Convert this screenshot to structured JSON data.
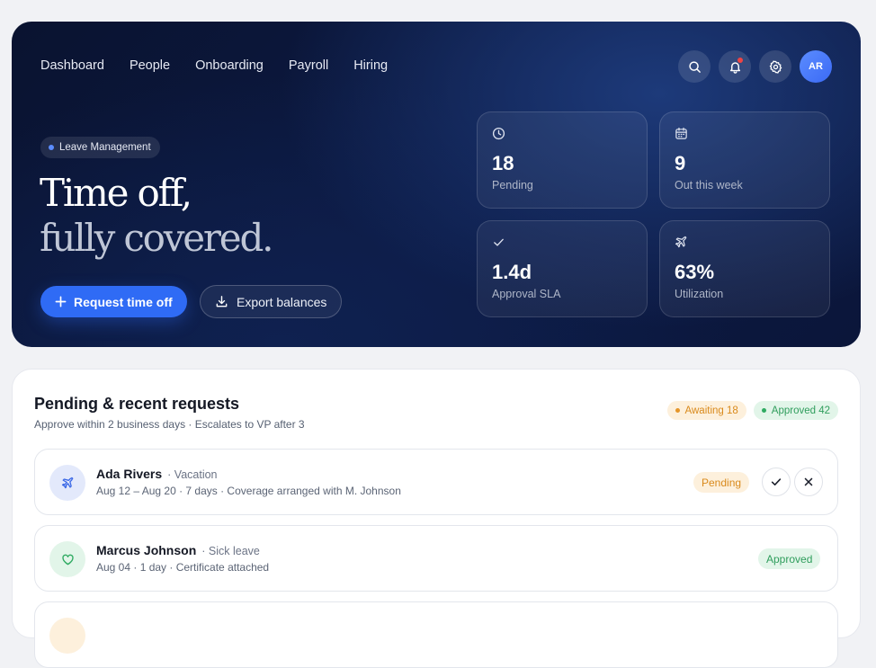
{
  "nav": {
    "items": [
      "Dashboard",
      "People",
      "Onboarding",
      "Payroll",
      "Hiring"
    ],
    "avatar_initials": "AR",
    "icons": [
      "search-icon",
      "bell-icon",
      "gear-icon"
    ]
  },
  "hero": {
    "chip": "Leave Management",
    "headline_line1": "Time off,",
    "headline_line2": "fully covered.",
    "primary_button": "Request time off",
    "secondary_button": "Export balances"
  },
  "stats": [
    {
      "icon": "clock-icon",
      "value": "18",
      "label": "Pending"
    },
    {
      "icon": "calendar-icon",
      "value": "9",
      "label": "Out this week"
    },
    {
      "icon": "check-icon",
      "value": "1.4d",
      "label": "Approval SLA"
    },
    {
      "icon": "plane-icon",
      "value": "63%",
      "label": "Utilization"
    }
  ],
  "requests_card": {
    "title": "Pending & recent requests",
    "subtitle": "Approve within 2 business days · Escalates to VP after 3",
    "badge_awaiting": "Awaiting 18",
    "badge_approved": "Approved 42",
    "rows": [
      {
        "name": "Ada Rivers",
        "type": "· Vacation",
        "detail": "Aug 12 – Aug 20 · 7 days · Coverage arranged with M. Johnson",
        "status": "Pending",
        "icon": "plane-icon"
      },
      {
        "name": "Marcus Johnson",
        "type": "· Sick leave",
        "detail": "Aug 04 · 1 day · Certificate attached",
        "status": "Approved",
        "icon": "heart-icon"
      }
    ]
  },
  "colors": {
    "accent": "#2f6bf5",
    "pending": "#d98a1c",
    "approved": "#2f9d5c",
    "hero_bg": "#0b163a"
  }
}
